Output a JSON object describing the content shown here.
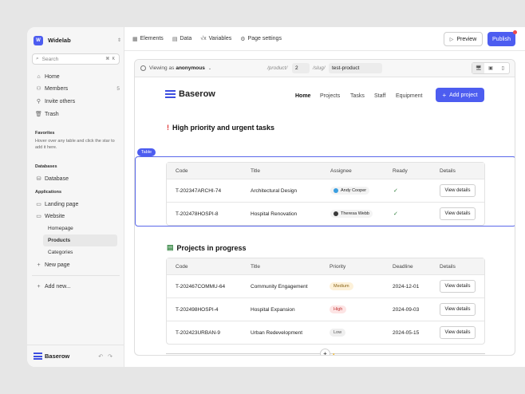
{
  "workspace": {
    "badge": "W",
    "name": "Widelab"
  },
  "sidebar": {
    "search_placeholder": "Search",
    "search_shortcut": "⌘ K",
    "nav": [
      {
        "label": "Home",
        "icon": "home-icon"
      },
      {
        "label": "Members",
        "icon": "members-icon",
        "count": "5"
      },
      {
        "label": "Invite others",
        "icon": "invite-icon"
      },
      {
        "label": "Trash",
        "icon": "trash-icon"
      }
    ],
    "favorites_title": "Favorites",
    "favorites_note": "Hover over any table and click the star to add it here.",
    "databases_title": "Databases",
    "database_item": "Database",
    "applications_title": "Applications",
    "app_items": [
      "Landing page",
      "Website"
    ],
    "website_pages": [
      "Homepage",
      "Products",
      "Categories"
    ],
    "new_page": "New page",
    "add_new": "Add new...",
    "footer_logo": "Baserow"
  },
  "topbar": {
    "elements": "Elements",
    "data": "Data",
    "variables": "Variables",
    "page_settings": "Page settings",
    "preview": "Preview",
    "publish": "Publish"
  },
  "pagebar": {
    "viewing_prefix": "Viewing as",
    "viewing_user": "anonymous",
    "product_param": "/product/",
    "product_value": "2",
    "slug_param": "/slug/",
    "slug_value": "test-product"
  },
  "page": {
    "brand": "Baserow",
    "nav": [
      "Home",
      "Projects",
      "Tasks",
      "Staff",
      "Equipment"
    ],
    "add_project": "Add project",
    "table_tag": "Table",
    "tasks_title": "High priority and urgent tasks",
    "tasks_headers": [
      "Code",
      "Title",
      "Assignee",
      "Ready",
      "Details"
    ],
    "tasks_rows": [
      {
        "code": "T-202347ARCHI-74",
        "title": "Architectural Design",
        "assignee": "Andy Cooper",
        "ready": "✓",
        "details": "View details"
      },
      {
        "code": "T-202478HOSPI-8",
        "title": "Hospital Renovation",
        "assignee": "Theresa Webb",
        "ready": "✓",
        "details": "View details"
      }
    ],
    "projects_title": "Projects in progress",
    "projects_headers": [
      "Code",
      "Title",
      "Priority",
      "Deadline",
      "Details"
    ],
    "projects_rows": [
      {
        "code": "T-202467COMMU-64",
        "title": "Community Engagement",
        "priority": "Medium",
        "deadline": "2024-12-01",
        "details": "View details"
      },
      {
        "code": "T-202498HOSPI-4",
        "title": "Hospital Expansion",
        "priority": "High",
        "deadline": "2024-09-03",
        "details": "View details"
      },
      {
        "code": "T-202423URBAN-9",
        "title": "Urban Redevelopment",
        "priority": "Low",
        "deadline": "2024-05-15",
        "details": "View details"
      }
    ]
  },
  "colors": {
    "accent": "#4d5df0",
    "priority_medium_bg": "#fdf1d9",
    "priority_medium_fg": "#8a6418",
    "priority_high_bg": "#fde4e4",
    "priority_high_fg": "#c03434",
    "priority_low_bg": "#efefef",
    "priority_low_fg": "#555555"
  }
}
